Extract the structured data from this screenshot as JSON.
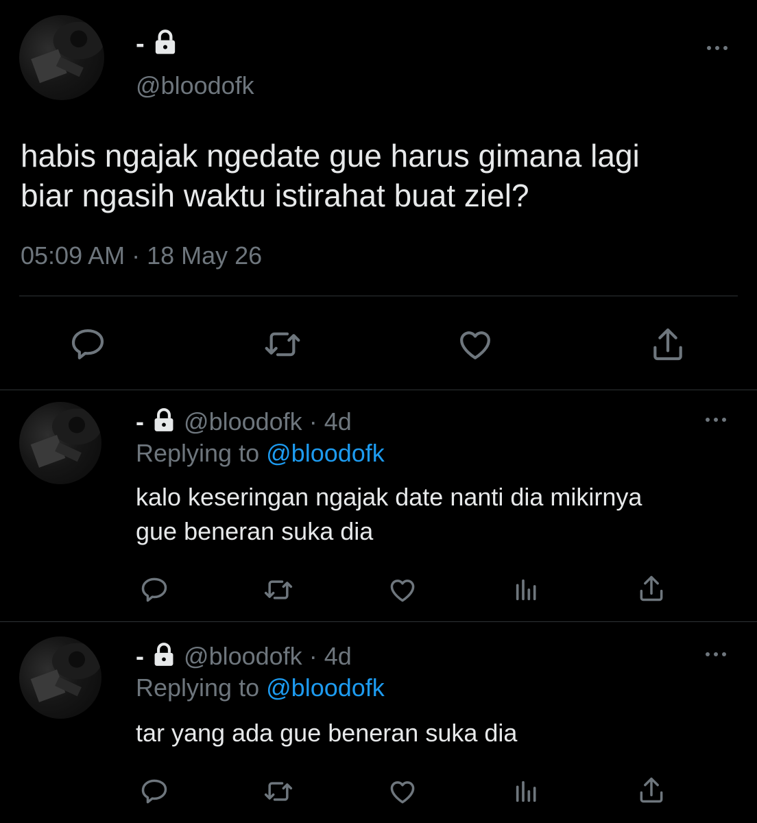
{
  "main_tweet": {
    "display_name": "-",
    "handle": "@bloodofk",
    "text_line1": "habis ngajak ngedate gue harus gimana lagi",
    "text_line2": "biar ngasih waktu istirahat buat ziel?",
    "timestamp": "05:09 AM · 18 May 26",
    "actions": [
      "reply-icon",
      "retweet-icon",
      "like-icon",
      "share-icon"
    ]
  },
  "replies": [
    {
      "display_name": "-",
      "handle": "@bloodofk",
      "time": "· 4d",
      "replying_label": "Replying to",
      "replying_to": "@bloodofk",
      "text_line1": "kalo keseringan ngajak date nanti dia mikirnya",
      "text_line2": "gue beneran suka dia"
    },
    {
      "display_name": "-",
      "handle": "@bloodofk",
      "time": "· 4d",
      "replying_label": "Replying to",
      "replying_to": "@bloodofk",
      "text_line1": "tar yang ada gue beneran suka dia",
      "text_line2": ""
    }
  ],
  "colors": {
    "background": "#000000",
    "text": "#e7e9ea",
    "muted": "#6e767d",
    "link": "#1d9bf0",
    "divider": "#2f3336"
  }
}
